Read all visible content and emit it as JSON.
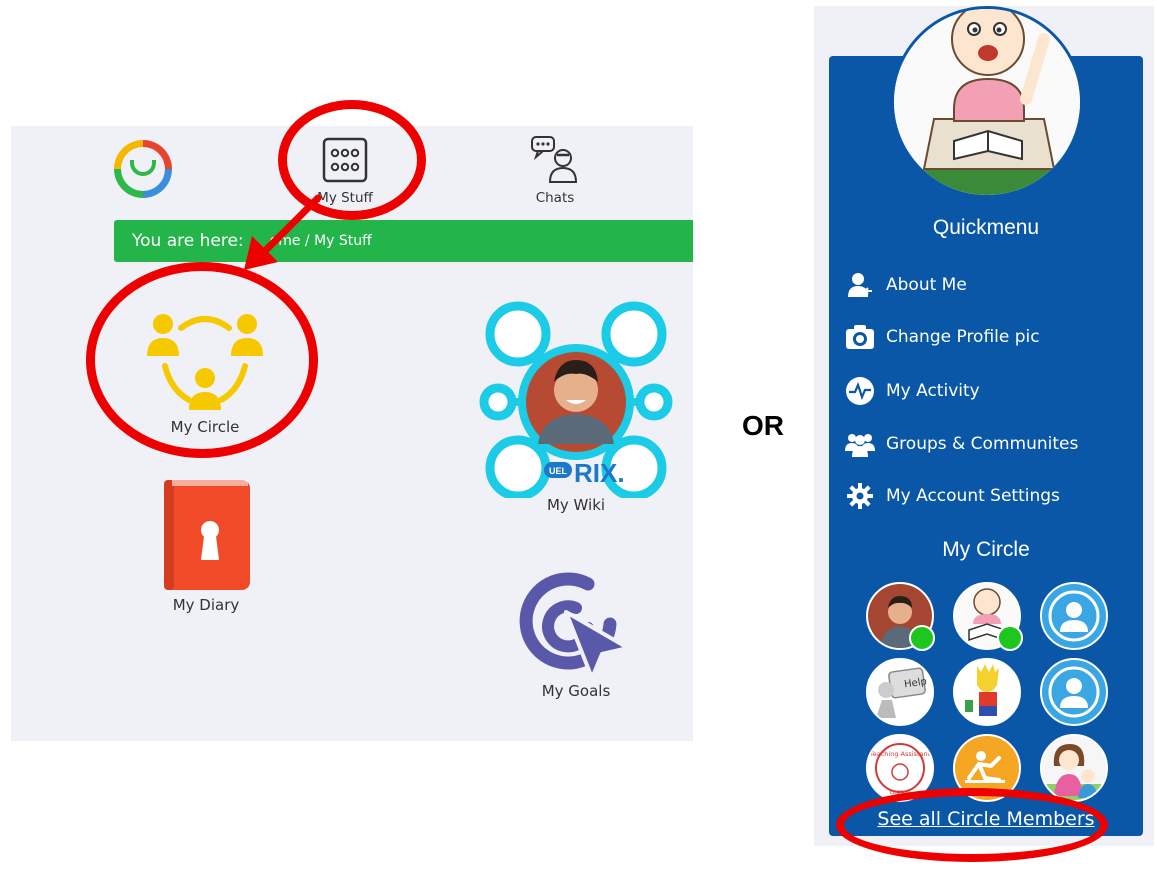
{
  "left_nav": {
    "my_stuff": "My Stuff",
    "chats": "Chats"
  },
  "breadcrumb": {
    "prefix": "You are here:",
    "path": "ome / My Stuff"
  },
  "tiles": {
    "my_circle": "My Circle",
    "my_wiki": "My Wiki",
    "my_diary": "My Diary",
    "my_goals": "My Goals",
    "wiki_badge": "UEL",
    "wiki_brand": "RIX."
  },
  "separator": "OR",
  "quickmenu": {
    "title": "Quickmenu",
    "items": [
      {
        "label": "About Me",
        "icon": "person-icon"
      },
      {
        "label": "Change Profile pic",
        "icon": "camera-icon"
      },
      {
        "label": "My Activity",
        "icon": "activity-pulse-icon"
      },
      {
        "label": "Groups & Communites",
        "icon": "group-icon"
      },
      {
        "label": "My Account Settings",
        "icon": "gear-icon"
      }
    ]
  },
  "my_circle": {
    "title": "My Circle",
    "see_all": "See all Circle Members",
    "member_help_label": "Help",
    "member_ta_label": "Teaching Assistant",
    "member_ta_sub": "Lesson"
  },
  "colors": {
    "breadcrumb_green": "#24b54a",
    "panel_blue": "#0a57a7",
    "annotation_red": "#ee0000",
    "circle_yellow": "#f5c800",
    "wiki_cyan": "#1ccbe6",
    "diary_red": "#f04a28",
    "goals_purple": "#5a58a8"
  }
}
